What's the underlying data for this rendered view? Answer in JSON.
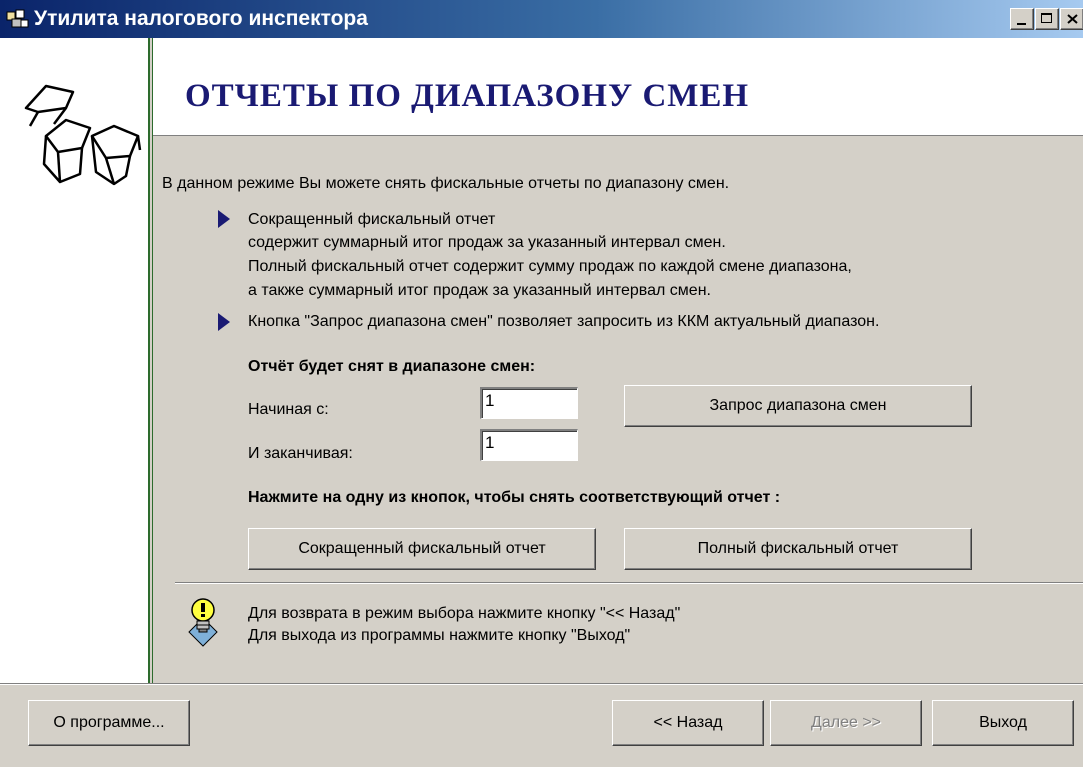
{
  "window": {
    "title": "Утилита налогового инспектора"
  },
  "header": {
    "page_title": "ОТЧЕТЫ ПО ДИАПАЗОНУ СМЕН"
  },
  "content": {
    "intro": "В данном режиме Вы можете снять фискальные отчеты по диапазону смен.",
    "bullet1": {
      "line1": "Сокращенный фискальный отчет",
      "line2": "содержит суммарный итог продаж за указанный интервал смен.",
      "line3": "Полный фискальный отчет содержит сумму продаж по каждой смене диапазона,",
      "line4": "а также суммарный итог продаж за указанный интервал смен."
    },
    "bullet2": "Кнопка \"Запрос диапазона смен\" позволяет запросить из ККМ актуальный диапазон.",
    "range_heading": "Отчёт будет снят в диапазоне смен:",
    "start_label": "Начиная с:",
    "start_value": "1",
    "end_label": "И заканчивая:",
    "end_value": "1",
    "request_range_button": "Запрос диапазона смен",
    "press_heading": "Нажмите на одну из кнопок, чтобы снять соответствующий отчет :",
    "short_report_button": "Сокращенный фискальный отчет",
    "full_report_button": "Полный фискальный отчет",
    "tip_line1": "Для возврата в режим выбора  нажмите кнопку \"<< Назад\"",
    "tip_line2": "Для выхода из программы нажмите кнопку \"Выход\""
  },
  "footer": {
    "about_button": "О программе...",
    "back_button": "<< Назад",
    "next_button": "Далее >>",
    "exit_button": "Выход"
  },
  "colors": {
    "title_bar": "#0a246a",
    "page_title": "#1a1a73",
    "bullet": "#1a1a73",
    "sidebar_border": "#2d6b2d",
    "face": "#d4d0c8"
  },
  "icons": {
    "app": "app-icon",
    "logo": "boxes-logo",
    "bullet": "triangle-bullet-icon",
    "tip": "lightbulb-icon"
  }
}
